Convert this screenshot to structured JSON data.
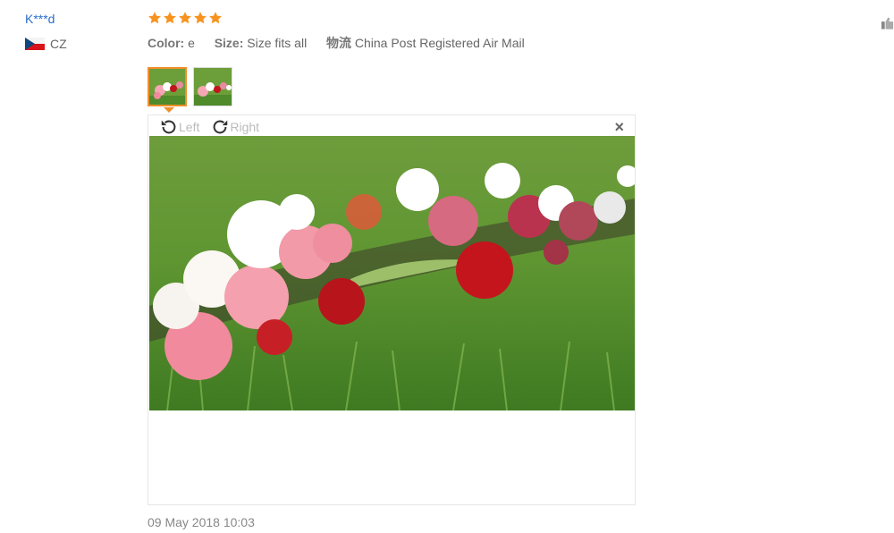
{
  "review": {
    "user_name": "K***d",
    "country_code": "CZ",
    "rating": 5,
    "color_key": "Color:",
    "color_value": "e",
    "size_key": "Size:",
    "size_value": "Size fits all",
    "shipping_key": "物流",
    "shipping_value": "China Post Registered Air Mail",
    "date": "09 May 2018 10:03"
  },
  "viewer": {
    "rotate_left_label": "Left",
    "rotate_right_label": "Right",
    "close_label": "×"
  },
  "thumbnails": [
    {
      "name": "thumbnail-1",
      "active": true
    },
    {
      "name": "thumbnail-2",
      "active": false
    }
  ],
  "colors": {
    "user_link": "#2a6fc9",
    "star": "#f7931e",
    "active_thumb_border": "#f08f2a"
  },
  "icons": {
    "rotate_left": "rotate-left-icon",
    "rotate_right": "rotate-right-icon",
    "close": "close-icon",
    "flag": "czech-flag-icon",
    "star": "star-icon",
    "side": "thumb-like-icon"
  }
}
